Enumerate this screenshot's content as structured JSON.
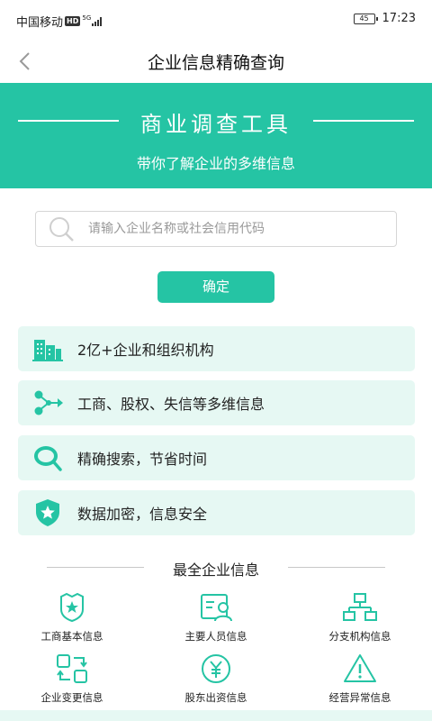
{
  "status_bar": {
    "carrier": "中国移动",
    "hd": "HD",
    "network": "5G",
    "battery": "45",
    "time": "17:23"
  },
  "nav": {
    "back_icon": "chevron-left-icon",
    "title": "企业信息精确查询"
  },
  "hero": {
    "title": "商业调查工具",
    "subtitle": "带你了解企业的多维信息"
  },
  "search": {
    "placeholder": "请输入企业名称或社会信用代码",
    "value": ""
  },
  "confirm_label": "确定",
  "features": [
    {
      "icon": "buildings-icon",
      "label": "2亿+企业和组织机构"
    },
    {
      "icon": "share-nodes-icon",
      "label": "工商、股权、失信等多维信息"
    },
    {
      "icon": "search-chat-icon",
      "label": "精确搜索，节省时间"
    },
    {
      "icon": "shield-star-icon",
      "label": "数据加密，信息安全"
    }
  ],
  "section_title": "最全企业信息",
  "grid": [
    {
      "icon": "badge-icon",
      "label": "工商基本信息"
    },
    {
      "icon": "id-card-icon",
      "label": "主要人员信息"
    },
    {
      "icon": "org-chart-icon",
      "label": "分支机构信息"
    },
    {
      "icon": "swap-icon",
      "label": "企业变更信息"
    },
    {
      "icon": "yen-circle-icon",
      "label": "股东出资信息"
    },
    {
      "icon": "warning-triangle-icon",
      "label": "经营异常信息"
    }
  ],
  "colors": {
    "brand": "#25c4a4",
    "card_bg": "#e6f8f3"
  }
}
